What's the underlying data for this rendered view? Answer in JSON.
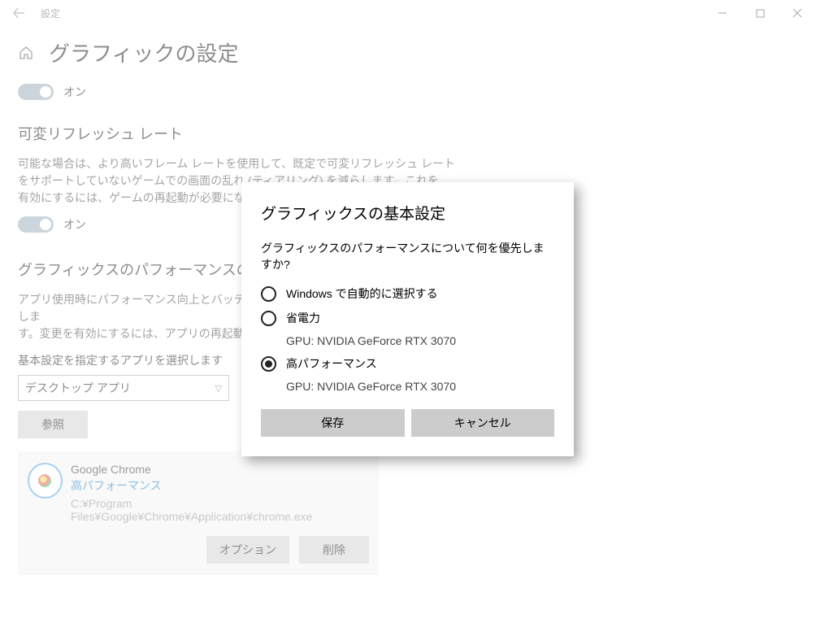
{
  "titlebar": {
    "title": "設定"
  },
  "page": {
    "title": "グラフィックの設定",
    "toggle1_label": "オン",
    "vrr_title": "可変リフレッシュ レート",
    "vrr_desc": "可能な場合は、より高いフレーム レートを使用して、既定で可変リフレッシュ レート\nをサポートしていないゲームでの画面の乱れ (ティアリング) を減らします。これを\n有効にするには、ゲームの再起動が必要になる場合があります。",
    "toggle2_label": "オン",
    "perf_title": "グラフィックスのパフォーマンスの基本設定",
    "perf_desc": "アプリ使用時にパフォーマンス向上とバッテリー残量節約のためにアプリをカスタマイズしま\nす。変更を有効にするには、アプリの再起動が必要になる場合があります。",
    "app_select_label": "基本設定を指定するアプリを選択します",
    "app_select_value": "デスクトップ アプリ",
    "browse_label": "参照"
  },
  "app": {
    "name": "Google Chrome",
    "perf": "高パフォーマンス",
    "path": "C:¥Program Files¥Google¥Chrome¥Application¥chrome.exe",
    "options_label": "オプション",
    "remove_label": "削除"
  },
  "dialog": {
    "title": "グラフィックスの基本設定",
    "subtitle": "グラフィックスのパフォーマンスについて何を優先しますか?",
    "opt1": "Windows で自動的に選択する",
    "opt2": "省電力",
    "opt2_gpu": "GPU: NVIDIA GeForce RTX 3070",
    "opt3": "高パフォーマンス",
    "opt3_gpu": "GPU: NVIDIA GeForce RTX 3070",
    "selected": "opt3",
    "save": "保存",
    "cancel": "キャンセル"
  }
}
